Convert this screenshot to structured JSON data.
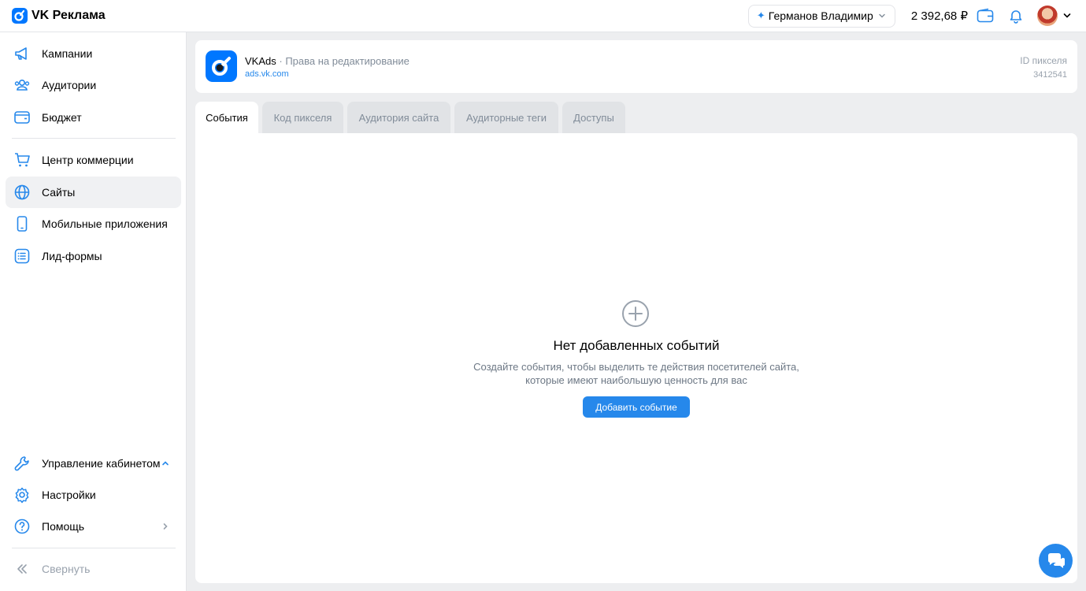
{
  "app": {
    "title": "VK Реклама"
  },
  "topbar": {
    "account_name": "Германов Владимир",
    "balance": "2 392,68 ₽"
  },
  "sidebar": {
    "items": [
      {
        "label": "Кампании"
      },
      {
        "label": "Аудитории"
      },
      {
        "label": "Бюджет"
      },
      {
        "label": "Центр коммерции"
      },
      {
        "label": "Сайты"
      },
      {
        "label": "Мобильные приложения"
      },
      {
        "label": "Лид-формы"
      }
    ],
    "bottom": [
      {
        "label": "Управление кабинетом"
      },
      {
        "label": "Настройки"
      },
      {
        "label": "Помощь"
      }
    ],
    "collapse_label": "Свернуть"
  },
  "site": {
    "name": "VKAds",
    "permission": "· Права на редактирование",
    "url": "ads.vk.com",
    "pixel_id_label": "ID пикселя",
    "pixel_id": "3412541"
  },
  "tabs": [
    {
      "label": "События"
    },
    {
      "label": "Код пикселя"
    },
    {
      "label": "Аудитория сайта"
    },
    {
      "label": "Аудиторные теги"
    },
    {
      "label": "Доступы"
    }
  ],
  "empty_state": {
    "title": "Нет добавленных событий",
    "description_line1": "Создайте события, чтобы выделить те действия посетителей сайта,",
    "description_line2": "которые имеют наибольшую ценность для вас",
    "button_label": "Добавить событие"
  },
  "colors": {
    "accent": "#2688eb",
    "brand": "#0077ff"
  }
}
